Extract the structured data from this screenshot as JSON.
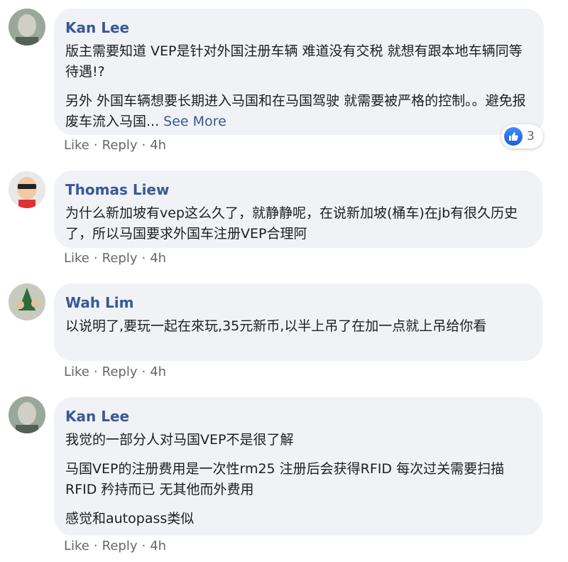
{
  "comments": [
    {
      "author": "Kan Lee",
      "paragraphs": [
        "版主需要知道 VEP是针对外国注册车辆 难道没有交税 就想有跟本地车辆同等待遇!?",
        "另外 外国车辆想要长期进入马国和在马国驾驶 就需要被严格的控制。。避免报废车流入马国..."
      ],
      "see_more": "See More",
      "like": "Like",
      "reply": "Reply",
      "time": "4h",
      "reaction_count": "3",
      "sep": "·"
    },
    {
      "author": "Thomas Liew",
      "paragraphs": [
        "为什么新加坡有vep这么久了，就静静呢，在说新加坡(桶车)在jb有很久历史了，所以马国要求外国车注册VEP合理阿"
      ],
      "like": "Like",
      "reply": "Reply",
      "time": "4h",
      "sep": "·"
    },
    {
      "author": "Wah Lim",
      "paragraphs": [
        "以说明了,要玩一起在來玩,35元新币,以半上吊了在加一点就上吊给你看"
      ],
      "like": "Like",
      "reply": "Reply",
      "time": "4h",
      "sep": "·"
    },
    {
      "author": "Kan Lee",
      "paragraphs": [
        "我觉的一部分人对马国VEP不是很了解",
        "马国VEP的注册费用是一次性rm25 注册后会获得RFID 每次过关需要扫描RFID 矜持而已 无其他而外费用",
        "感觉和autopass类似"
      ],
      "like": "Like",
      "reply": "Reply",
      "time": "4h",
      "sep": "·"
    }
  ],
  "colors": {
    "author": "#385898",
    "bubble": "#f0f2f5",
    "meta": "#65676b",
    "like_badge": "#1f6feb"
  }
}
